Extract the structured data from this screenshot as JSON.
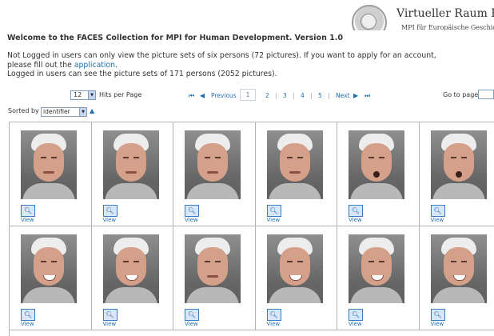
{
  "logo": {
    "title": "Virtueller Raum Reich",
    "subtitle": "MPI für Europäische Geschichte der Wissenschaften"
  },
  "welcome": "Welcome to the FACES Collection for MPI for Human Development. Version 1.0",
  "intro": {
    "line1": "Not Logged in users can only view the picture sets of six persons (72 pictures). If you want to apply for an account, please fill out the ",
    "link": "application",
    "line1_end": ".",
    "line2": "Logged in users can see the picture sets of 171 persons (2052 pictures)."
  },
  "controls": {
    "hits_value": "12",
    "hits_label": "Hits per Page",
    "pager": {
      "previous": "Previous",
      "next": "Next",
      "pages": [
        "1",
        "2",
        "3",
        "4",
        "5"
      ],
      "current": "1"
    },
    "goto_label": "Go to page",
    "sort_label": "Sorted by",
    "sort_value": "identifier",
    "sort_arrow_icon": "sort-ascending-icon"
  },
  "grid": {
    "view_label": "View",
    "rows": [
      [
        {
          "expr": "neutral"
        },
        {
          "expr": "neutral"
        },
        {
          "expr": "neutral"
        },
        {
          "expr": "neutral"
        },
        {
          "expr": "open"
        },
        {
          "expr": "open"
        }
      ],
      [
        {
          "expr": "smile"
        },
        {
          "expr": "smile"
        },
        {
          "expr": "neutral"
        },
        {
          "expr": "smile"
        },
        {
          "expr": "smile"
        },
        {
          "expr": "smile"
        }
      ]
    ]
  },
  "colors": {
    "link": "#1f6fb3",
    "border": "#b4b4b4"
  }
}
